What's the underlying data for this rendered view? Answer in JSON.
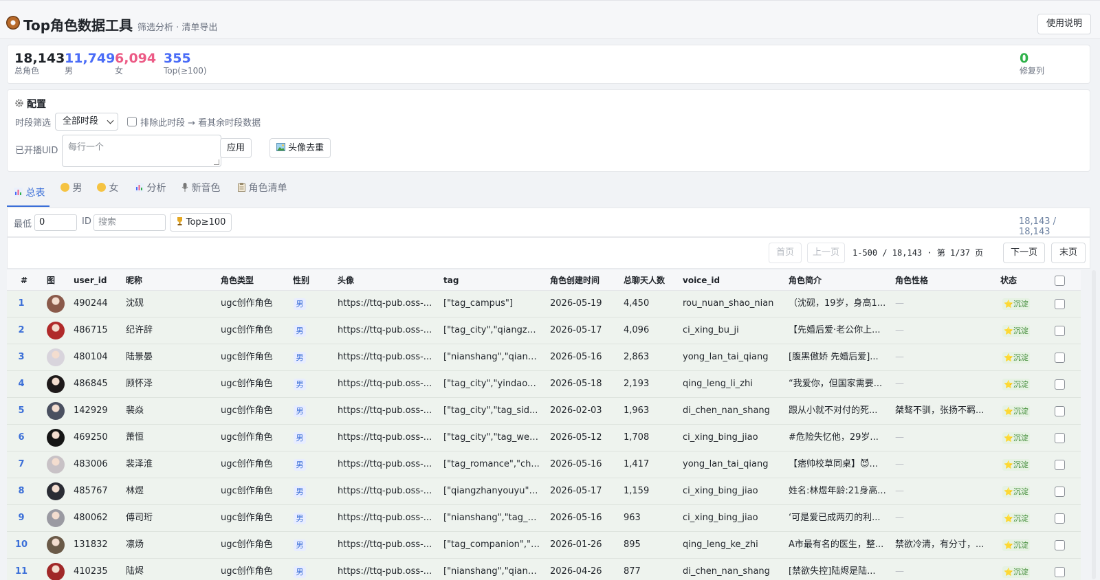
{
  "header": {
    "title": "Top角色数据工具",
    "subtitle": "筛选分析 · 清单导出",
    "help_label": "使用说明"
  },
  "stats": {
    "total": {
      "value": "18,143",
      "label": "总角色",
      "color": "#1f2329"
    },
    "male": {
      "value": "11,749",
      "label": "男",
      "color": "#4a6cf7"
    },
    "female": {
      "value": "6,094",
      "label": "女",
      "color": "#ec5b86"
    },
    "top": {
      "value": "355",
      "label": "Top(≥100)",
      "color": "#4a6cf7"
    },
    "fixed": {
      "value": "0",
      "label": "修复列",
      "color": "#2fb14a"
    }
  },
  "config": {
    "title": "配置",
    "period_label": "时段筛选",
    "period_value": "全部时段",
    "exclude_label": "排除此时段 → 看其余时段数据",
    "uid_label": "已开播UID",
    "uid_placeholder": "每行一个",
    "apply_label": "应用",
    "dedupe_label": "头像去重"
  },
  "tabs": [
    {
      "label": "总表",
      "icon": "bar-chart-icon",
      "active": true
    },
    {
      "label": "男",
      "icon": "male-face-icon"
    },
    {
      "label": "女",
      "icon": "female-face-icon"
    },
    {
      "label": "分析",
      "icon": "bar-chart-icon"
    },
    {
      "label": "新音色",
      "icon": "microphone-icon"
    },
    {
      "label": "角色清单",
      "icon": "clipboard-icon"
    }
  ],
  "filter": {
    "min_label": "最低",
    "min_value": "0",
    "id_label": "ID",
    "search_placeholder": "搜索",
    "top_button": "Top≥100",
    "count": "18,143 / 18,143"
  },
  "pager": {
    "first": "首页",
    "prev": "上一页",
    "info": "1-500 / 18,143 · 第 1/37 页",
    "next": "下一页",
    "last": "末页"
  },
  "table": {
    "columns": [
      "#",
      "图",
      "user_id",
      "昵称",
      "角色类型",
      "性别",
      "头像",
      "tag",
      "角色创建时间",
      "总聊天人数",
      "voice_id",
      "角色简介",
      "角色性格",
      "状态"
    ],
    "rows": [
      {
        "idx": "1",
        "user_id": "490244",
        "nick": "沈砚",
        "type": "ugc创作角色",
        "gender": "男",
        "avatar_url": "https://ttq-pub.oss-...",
        "tag": "[\"tag_campus\"]",
        "created": "2026-05-19",
        "chats": "4,450",
        "voice": "rou_nuan_shao_nian",
        "intro": "（沈砚，19岁，身高1...",
        "persona": "—",
        "status": "⭐沉淀",
        "avatar_color": "#8a5a4a"
      },
      {
        "idx": "2",
        "user_id": "486715",
        "nick": "纪许辞",
        "type": "ugc创作角色",
        "gender": "男",
        "avatar_url": "https://ttq-pub.oss-...",
        "tag": "[\"tag_city\",\"qiangzh...",
        "created": "2026-05-17",
        "chats": "4,096",
        "voice": "ci_xing_bu_ji",
        "intro": "【先婚后爱·老公你上...",
        "persona": "—",
        "status": "⭐沉淀",
        "avatar_color": "#b02a2a"
      },
      {
        "idx": "3",
        "user_id": "480104",
        "nick": "陆景晏",
        "type": "ugc创作角色",
        "gender": "男",
        "avatar_url": "https://ttq-pub.oss-...",
        "tag": "[\"nianshang\",\"qiangf...",
        "created": "2026-05-16",
        "chats": "2,863",
        "voice": "yong_lan_tai_qiang",
        "intro": "[腹黑傲娇 先婚后爱]...",
        "persona": "—",
        "status": "⭐沉淀",
        "avatar_color": "#d8d4dc"
      },
      {
        "idx": "4",
        "user_id": "486845",
        "nick": "顾怀泽",
        "type": "ugc创作角色",
        "gender": "男",
        "avatar_url": "https://ttq-pub.oss-...",
        "tag": "[\"tag_city\",\"yindaox...",
        "created": "2026-05-18",
        "chats": "2,193",
        "voice": "qing_leng_li_zhi",
        "intro": "“我爱你，但国家需要...",
        "persona": "—",
        "status": "⭐沉淀",
        "avatar_color": "#1e1a1a"
      },
      {
        "idx": "5",
        "user_id": "142929",
        "nick": "裴焱",
        "type": "ugc创作角色",
        "gender": "男",
        "avatar_url": "https://ttq-pub.oss-...",
        "tag": "[\"tag_city\",\"tag_sid...",
        "created": "2026-02-03",
        "chats": "1,963",
        "voice": "di_chen_nan_shang",
        "intro": "跟从小就不对付的死...",
        "persona": "桀骜不驯，张扬不羁...",
        "status": "⭐沉淀",
        "avatar_color": "#4a5060"
      },
      {
        "idx": "6",
        "user_id": "469250",
        "nick": "萧恒",
        "type": "ugc创作角色",
        "gender": "男",
        "avatar_url": "https://ttq-pub.oss-...",
        "tag": "[\"tag_city\",\"tag_wei...",
        "created": "2026-05-12",
        "chats": "1,708",
        "voice": "ci_xing_bing_jiao",
        "intro": "#危险失忆他，29岁...",
        "persona": "—",
        "status": "⭐沉淀",
        "avatar_color": "#151515"
      },
      {
        "idx": "7",
        "user_id": "483006",
        "nick": "裴泽淮",
        "type": "ugc创作角色",
        "gender": "男",
        "avatar_url": "https://ttq-pub.oss-...",
        "tag": "[\"tag_romance\",\"ch...",
        "created": "2026-05-16",
        "chats": "1,417",
        "voice": "yong_lan_tai_qiang",
        "intro": "【痞帅校草同桌】😈...",
        "persona": "—",
        "status": "⭐沉淀",
        "avatar_color": "#c8c2c6"
      },
      {
        "idx": "8",
        "user_id": "485767",
        "nick": "林煜",
        "type": "ugc创作角色",
        "gender": "男",
        "avatar_url": "https://ttq-pub.oss-...",
        "tag": "[\"qiangzhanyouyu\",\"...",
        "created": "2026-05-17",
        "chats": "1,159",
        "voice": "ci_xing_bing_jiao",
        "intro": "姓名:林煜年龄:21身高...",
        "persona": "—",
        "status": "⭐沉淀",
        "avatar_color": "#2a2c34"
      },
      {
        "idx": "9",
        "user_id": "480062",
        "nick": "傅司珩",
        "type": "ugc创作角色",
        "gender": "男",
        "avatar_url": "https://ttq-pub.oss-...",
        "tag": "[\"nianshang\",\"tag_ci...",
        "created": "2026-05-16",
        "chats": "963",
        "voice": "ci_xing_bing_jiao",
        "intro": "‘可是爱已成两刃的利...",
        "persona": "—",
        "status": "⭐沉淀",
        "avatar_color": "#9a9aa2"
      },
      {
        "idx": "10",
        "user_id": "131832",
        "nick": "凛炀",
        "type": "ugc创作角色",
        "gender": "男",
        "avatar_url": "https://ttq-pub.oss-...",
        "tag": "[\"tag_companion\",\"t...",
        "created": "2026-01-26",
        "chats": "895",
        "voice": "qing_leng_ke_zhi",
        "intro": "A市最有名的医生，整...",
        "persona": "禁欲冷清，有分寸，...",
        "status": "⭐沉淀",
        "avatar_color": "#6a5a48"
      },
      {
        "idx": "11",
        "user_id": "410235",
        "nick": "陆烬",
        "type": "ugc创作角色",
        "gender": "男",
        "avatar_url": "https://ttq-pub.oss-...",
        "tag": "[\"nianshang\",\"qiang...",
        "created": "2026-04-26",
        "chats": "877",
        "voice": "di_chen_nan_shang",
        "intro": "[禁欲失控]陆烬是陆...",
        "persona": "—",
        "status": "⭐沉淀",
        "avatar_color": "#a02828"
      }
    ]
  }
}
